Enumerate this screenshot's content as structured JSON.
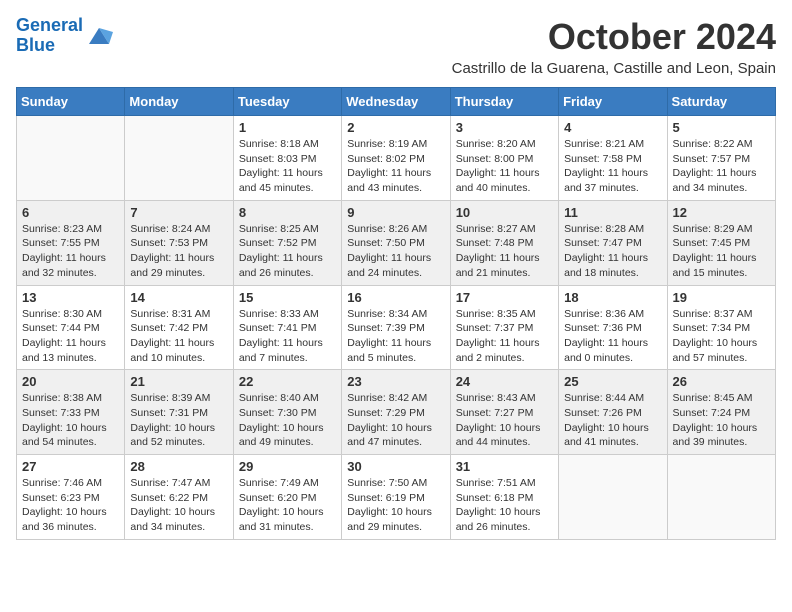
{
  "logo": {
    "text_general": "General",
    "text_blue": "Blue"
  },
  "title": "October 2024",
  "location": "Castrillo de la Guarena, Castille and Leon, Spain",
  "days_of_week": [
    "Sunday",
    "Monday",
    "Tuesday",
    "Wednesday",
    "Thursday",
    "Friday",
    "Saturday"
  ],
  "weeks": [
    [
      {
        "day": "",
        "info": ""
      },
      {
        "day": "",
        "info": ""
      },
      {
        "day": "1",
        "info": "Sunrise: 8:18 AM\nSunset: 8:03 PM\nDaylight: 11 hours and 45 minutes."
      },
      {
        "day": "2",
        "info": "Sunrise: 8:19 AM\nSunset: 8:02 PM\nDaylight: 11 hours and 43 minutes."
      },
      {
        "day": "3",
        "info": "Sunrise: 8:20 AM\nSunset: 8:00 PM\nDaylight: 11 hours and 40 minutes."
      },
      {
        "day": "4",
        "info": "Sunrise: 8:21 AM\nSunset: 7:58 PM\nDaylight: 11 hours and 37 minutes."
      },
      {
        "day": "5",
        "info": "Sunrise: 8:22 AM\nSunset: 7:57 PM\nDaylight: 11 hours and 34 minutes."
      }
    ],
    [
      {
        "day": "6",
        "info": "Sunrise: 8:23 AM\nSunset: 7:55 PM\nDaylight: 11 hours and 32 minutes."
      },
      {
        "day": "7",
        "info": "Sunrise: 8:24 AM\nSunset: 7:53 PM\nDaylight: 11 hours and 29 minutes."
      },
      {
        "day": "8",
        "info": "Sunrise: 8:25 AM\nSunset: 7:52 PM\nDaylight: 11 hours and 26 minutes."
      },
      {
        "day": "9",
        "info": "Sunrise: 8:26 AM\nSunset: 7:50 PM\nDaylight: 11 hours and 24 minutes."
      },
      {
        "day": "10",
        "info": "Sunrise: 8:27 AM\nSunset: 7:48 PM\nDaylight: 11 hours and 21 minutes."
      },
      {
        "day": "11",
        "info": "Sunrise: 8:28 AM\nSunset: 7:47 PM\nDaylight: 11 hours and 18 minutes."
      },
      {
        "day": "12",
        "info": "Sunrise: 8:29 AM\nSunset: 7:45 PM\nDaylight: 11 hours and 15 minutes."
      }
    ],
    [
      {
        "day": "13",
        "info": "Sunrise: 8:30 AM\nSunset: 7:44 PM\nDaylight: 11 hours and 13 minutes."
      },
      {
        "day": "14",
        "info": "Sunrise: 8:31 AM\nSunset: 7:42 PM\nDaylight: 11 hours and 10 minutes."
      },
      {
        "day": "15",
        "info": "Sunrise: 8:33 AM\nSunset: 7:41 PM\nDaylight: 11 hours and 7 minutes."
      },
      {
        "day": "16",
        "info": "Sunrise: 8:34 AM\nSunset: 7:39 PM\nDaylight: 11 hours and 5 minutes."
      },
      {
        "day": "17",
        "info": "Sunrise: 8:35 AM\nSunset: 7:37 PM\nDaylight: 11 hours and 2 minutes."
      },
      {
        "day": "18",
        "info": "Sunrise: 8:36 AM\nSunset: 7:36 PM\nDaylight: 11 hours and 0 minutes."
      },
      {
        "day": "19",
        "info": "Sunrise: 8:37 AM\nSunset: 7:34 PM\nDaylight: 10 hours and 57 minutes."
      }
    ],
    [
      {
        "day": "20",
        "info": "Sunrise: 8:38 AM\nSunset: 7:33 PM\nDaylight: 10 hours and 54 minutes."
      },
      {
        "day": "21",
        "info": "Sunrise: 8:39 AM\nSunset: 7:31 PM\nDaylight: 10 hours and 52 minutes."
      },
      {
        "day": "22",
        "info": "Sunrise: 8:40 AM\nSunset: 7:30 PM\nDaylight: 10 hours and 49 minutes."
      },
      {
        "day": "23",
        "info": "Sunrise: 8:42 AM\nSunset: 7:29 PM\nDaylight: 10 hours and 47 minutes."
      },
      {
        "day": "24",
        "info": "Sunrise: 8:43 AM\nSunset: 7:27 PM\nDaylight: 10 hours and 44 minutes."
      },
      {
        "day": "25",
        "info": "Sunrise: 8:44 AM\nSunset: 7:26 PM\nDaylight: 10 hours and 41 minutes."
      },
      {
        "day": "26",
        "info": "Sunrise: 8:45 AM\nSunset: 7:24 PM\nDaylight: 10 hours and 39 minutes."
      }
    ],
    [
      {
        "day": "27",
        "info": "Sunrise: 7:46 AM\nSunset: 6:23 PM\nDaylight: 10 hours and 36 minutes."
      },
      {
        "day": "28",
        "info": "Sunrise: 7:47 AM\nSunset: 6:22 PM\nDaylight: 10 hours and 34 minutes."
      },
      {
        "day": "29",
        "info": "Sunrise: 7:49 AM\nSunset: 6:20 PM\nDaylight: 10 hours and 31 minutes."
      },
      {
        "day": "30",
        "info": "Sunrise: 7:50 AM\nSunset: 6:19 PM\nDaylight: 10 hours and 29 minutes."
      },
      {
        "day": "31",
        "info": "Sunrise: 7:51 AM\nSunset: 6:18 PM\nDaylight: 10 hours and 26 minutes."
      },
      {
        "day": "",
        "info": ""
      },
      {
        "day": "",
        "info": ""
      }
    ]
  ]
}
